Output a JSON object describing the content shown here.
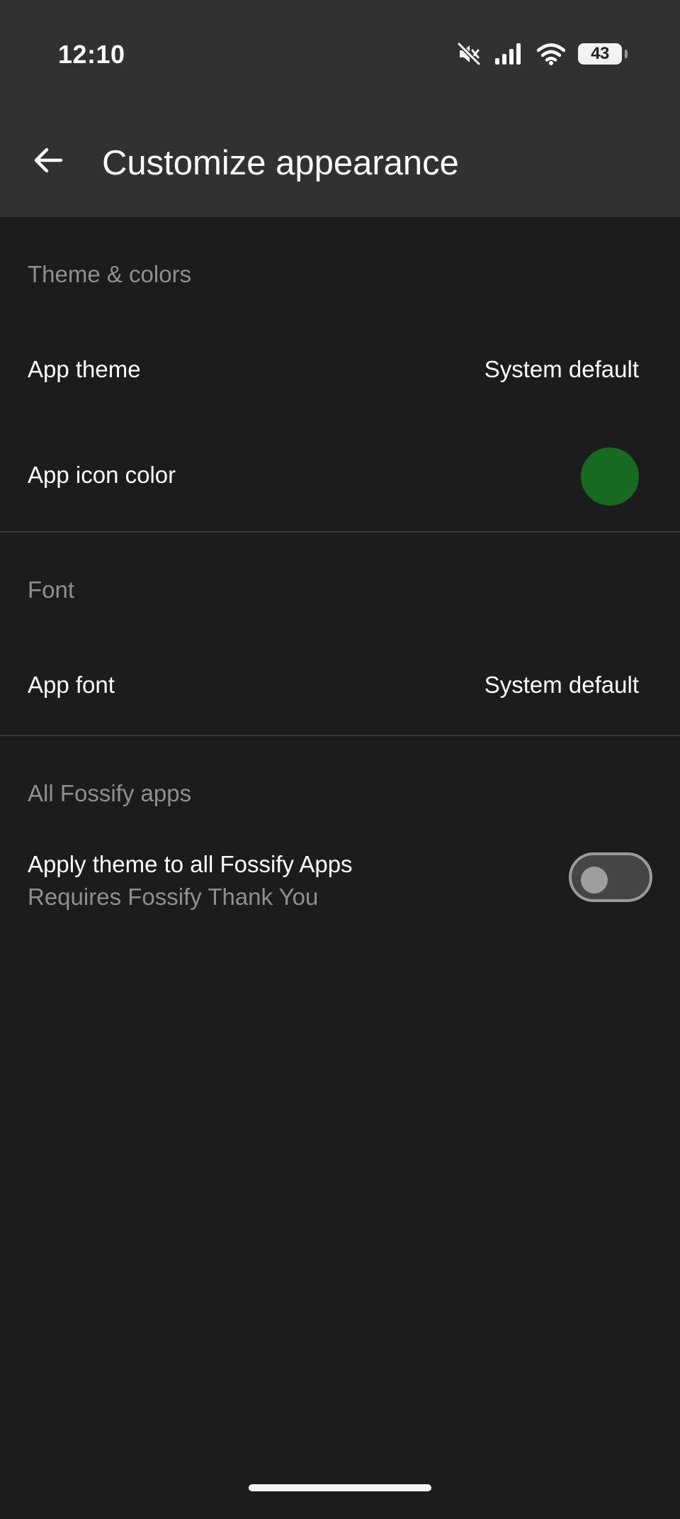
{
  "status_bar": {
    "time": "12:10",
    "battery": "43",
    "icons": [
      "mute-icon",
      "signal-icon",
      "wifi-icon",
      "battery-icon"
    ]
  },
  "toolbar": {
    "back_icon": "arrow-left-icon",
    "title": "Customize appearance"
  },
  "sections": {
    "theme": {
      "header": "Theme & colors",
      "app_theme_label": "App theme",
      "app_theme_value": "System default",
      "app_icon_color_label": "App icon color",
      "app_icon_color": "#166b20"
    },
    "font": {
      "header": "Font",
      "app_font_label": "App font",
      "app_font_value": "System default"
    },
    "fossify": {
      "header": "All Fossify apps",
      "apply_label": "Apply theme to all Fossify Apps",
      "apply_sub": "Requires Fossify Thank You",
      "apply_enabled": false
    }
  },
  "colors": {
    "toolbar_bg": "#313131",
    "page_bg": "#1c1c1c",
    "secondary_text": "#8f8f8f"
  }
}
